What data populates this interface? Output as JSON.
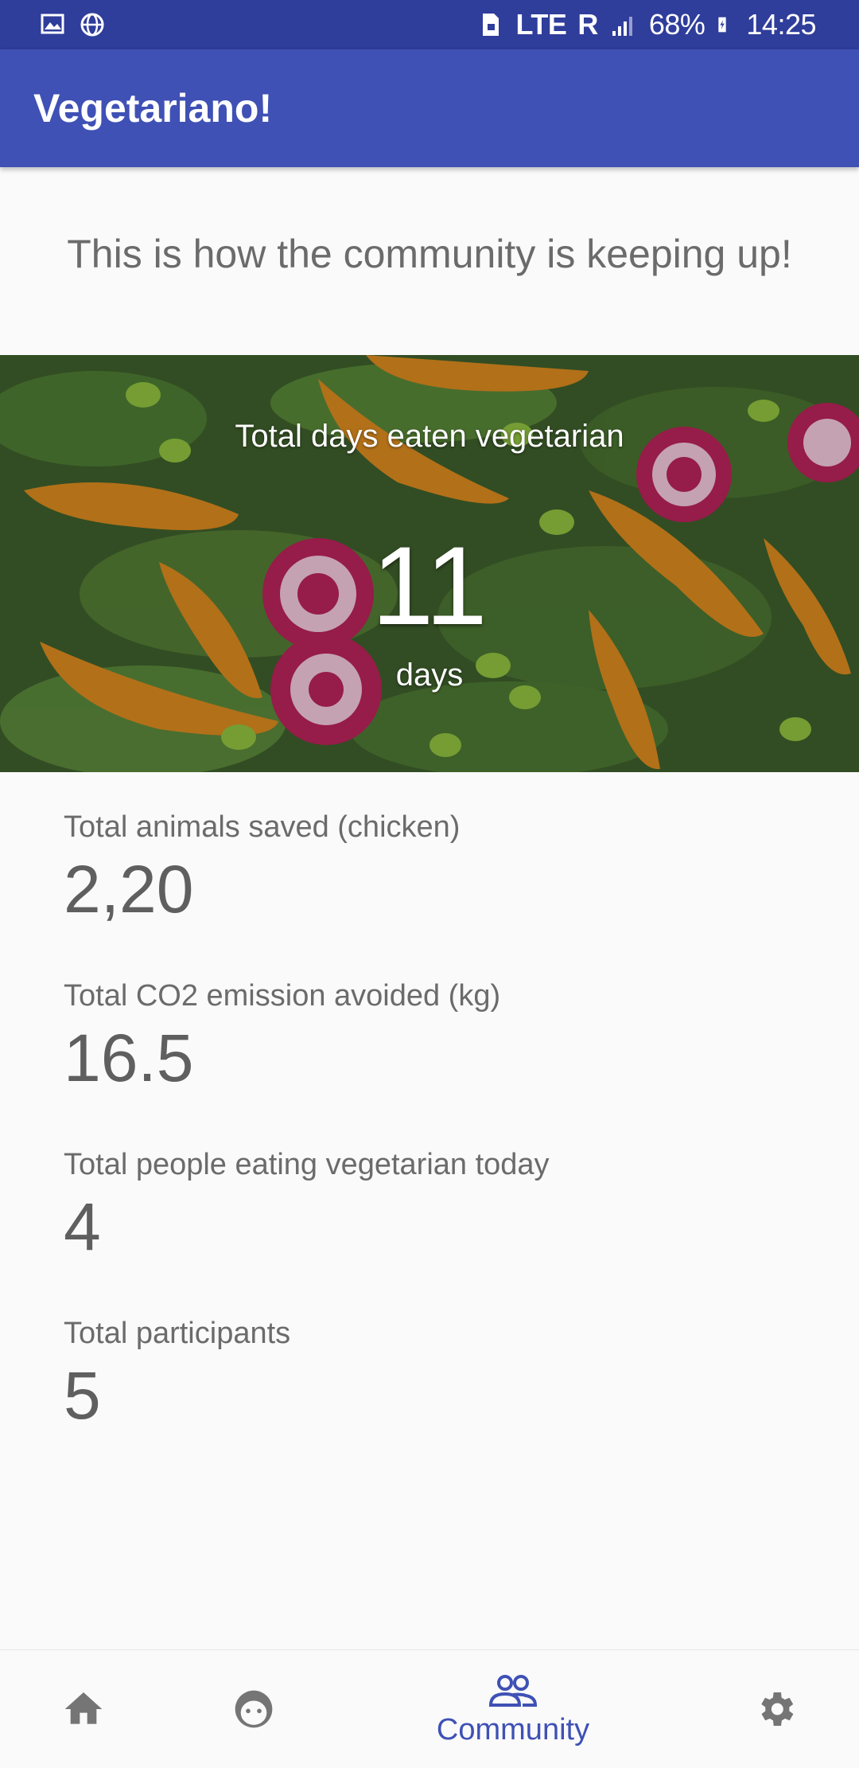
{
  "status_bar": {
    "network": "LTE",
    "roaming": "R",
    "battery": "68%",
    "time": "14:25"
  },
  "app_bar": {
    "title": "Vegetariano!"
  },
  "headline": "This is how the community is keeping up!",
  "hero": {
    "label": "Total days eaten vegetarian",
    "value": "11",
    "unit": "days"
  },
  "stats": [
    {
      "label": "Total animals saved (chicken)",
      "value": "2,20"
    },
    {
      "label": "Total CO2 emission avoided (kg)",
      "value": "16.5"
    },
    {
      "label": "Total people eating vegetarian today",
      "value": "4"
    },
    {
      "label": "Total participants",
      "value": "5"
    }
  ],
  "bottom_nav": {
    "items": [
      {
        "icon": "home-icon"
      },
      {
        "icon": "face-icon"
      },
      {
        "icon": "community-icon",
        "label": "Community",
        "active": true
      },
      {
        "icon": "settings-icon"
      }
    ],
    "active_color": "#3f51b5",
    "inactive_color": "#757575"
  },
  "colors": {
    "primary": "#3f51b5",
    "primary_dark": "#2f3d9b",
    "background": "#fafafa"
  }
}
